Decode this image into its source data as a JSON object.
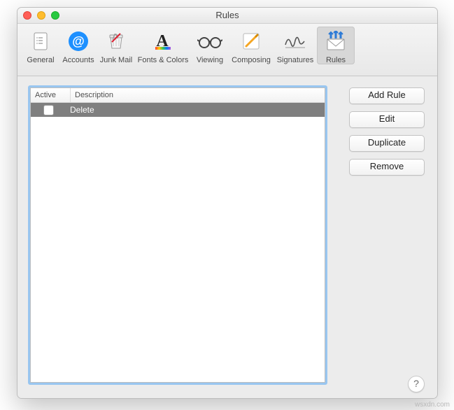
{
  "window": {
    "title": "Rules"
  },
  "toolbar": {
    "items": [
      {
        "label": "General"
      },
      {
        "label": "Accounts"
      },
      {
        "label": "Junk Mail"
      },
      {
        "label": "Fonts & Colors"
      },
      {
        "label": "Viewing"
      },
      {
        "label": "Composing"
      },
      {
        "label": "Signatures"
      },
      {
        "label": "Rules"
      }
    ],
    "selected_index": 7
  },
  "rules_table": {
    "columns": {
      "active": "Active",
      "description": "Description"
    },
    "rows": [
      {
        "active": false,
        "description": "Delete"
      }
    ]
  },
  "buttons": {
    "add": "Add Rule",
    "edit": "Edit",
    "duplicate": "Duplicate",
    "remove": "Remove"
  },
  "help": "?",
  "watermark": "wsxdn.com"
}
